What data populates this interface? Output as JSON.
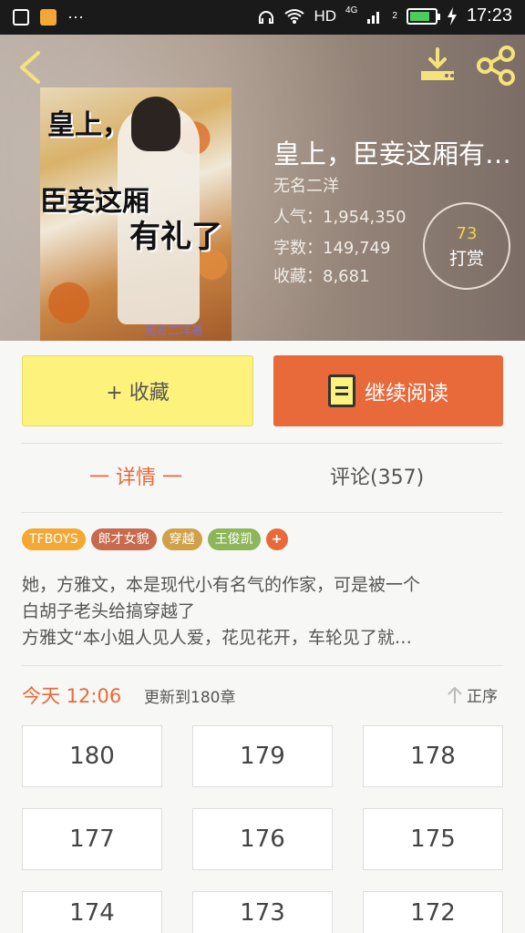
{
  "status_bar": {
    "dots": "···",
    "network": "HD",
    "net_type": "4G",
    "sim": "2",
    "time": "17:23"
  },
  "book": {
    "title": "皇上，臣妾这厢有…",
    "author": "无名二洋",
    "popularity": "人气：1,954,350",
    "words": "字数：149,749",
    "favorites": "收藏：8,681",
    "reward_count": "73",
    "reward_label": "打赏",
    "cover_text": {
      "line1": "皇上，",
      "line2": "臣妾这厢",
      "line3": "有礼了",
      "mark": "无名二洋著"
    }
  },
  "actions": {
    "collect_label": "+ 收藏",
    "read_label": "继续阅读"
  },
  "tabs": [
    {
      "label": "一 详情 一"
    },
    {
      "label": "评论(357)"
    }
  ],
  "tags": [
    {
      "label": "TFBOYS",
      "color": "#f3a833"
    },
    {
      "label": "郎才女貌",
      "color": "#c96a4e"
    },
    {
      "label": "穿越",
      "color": "#d1a14a"
    },
    {
      "label": "王俊凯",
      "color": "#8db65a"
    },
    {
      "label": "+",
      "color": "#e8693a"
    }
  ],
  "description": [
    "她，方雅文，本是现代小有名气的作家，可是被一个",
    "白胡子老头给搞穿越了",
    "方雅文“本小姐人见人爱，花见花开，车轮见了就…"
  ],
  "update": {
    "today": "今天 12:06",
    "text": "更新到180章",
    "sort_label": "正序"
  },
  "chapters": [
    "180",
    "179",
    "178",
    "177",
    "176",
    "175",
    "174",
    "173",
    "172"
  ],
  "colors": {
    "accent": "#e8693a",
    "collect_bg": "#fdf27c",
    "tab_active": "#e8693a"
  }
}
